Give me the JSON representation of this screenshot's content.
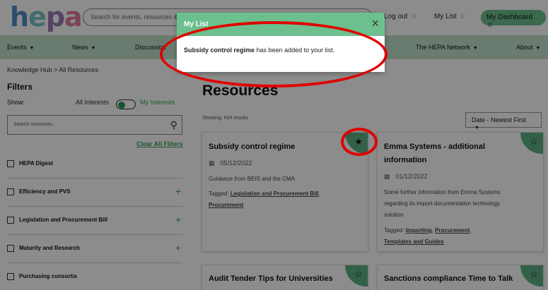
{
  "header": {
    "logo": [
      "h",
      "e",
      "p",
      "a"
    ],
    "search_placeholder": "Search for events, resources & m",
    "logout_label": "Log out",
    "mylist_label": "My List",
    "dashboard_label": "My Dashboard"
  },
  "nav": {
    "items": [
      "Events",
      "News",
      "Discussion",
      "The HEPA Network",
      "About"
    ]
  },
  "breadcrumb": "Knowledge Hub > All Resources",
  "filters": {
    "title": "Filters",
    "show_label": "Show:",
    "all_interests": "All Interests",
    "my_interests": "My Interests",
    "search_placeholder": "Search resources..",
    "clear_all": "Clear All Filters",
    "items": [
      "HEPA Digest",
      "Efficiency and PVS",
      "Legislation and Procurement Bill",
      "Maturity and Research",
      "Purchasing consortia"
    ]
  },
  "resources": {
    "title": "Resources",
    "showing": "Showing: 634 results",
    "sort_label": "Date - Newest First",
    "cards": [
      {
        "title": "Subsidy control regime",
        "date": "05/12/2022",
        "desc": "Guidance from BEIS and the CMA",
        "tags_label": "Tagged:",
        "tags": [
          "Legislation and Procurement Bill",
          "Procurement"
        ]
      },
      {
        "title_line1": "Emma Systems - additional",
        "title_line2": "information",
        "date": "01/12/2022",
        "desc_line1": "Some further information from Emma Systems",
        "desc_line2": "regarding its import documentation technology",
        "desc_line3": "solution",
        "tags_label": "Tagged:",
        "tags": [
          "Importing",
          "Procurement",
          "Templates and Guides"
        ]
      },
      {
        "title": "Audit Tender Tips for Universities"
      },
      {
        "title": "Sanctions compliance Time to Talk"
      }
    ]
  },
  "modal": {
    "title": "My List",
    "close": "×",
    "item_name": "Subsidy control regime",
    "message_suffix": "has been added to your list."
  },
  "icons": {
    "user": "user-icon",
    "star": "star-icon",
    "search": "search-icon",
    "calendar": "calendar-icon",
    "plus": "plus-icon",
    "close": "close-icon"
  },
  "colors": {
    "accent_green": "#6cc08e",
    "nav_bg": "#bfe2cb",
    "annotation_red": "#e00000"
  }
}
